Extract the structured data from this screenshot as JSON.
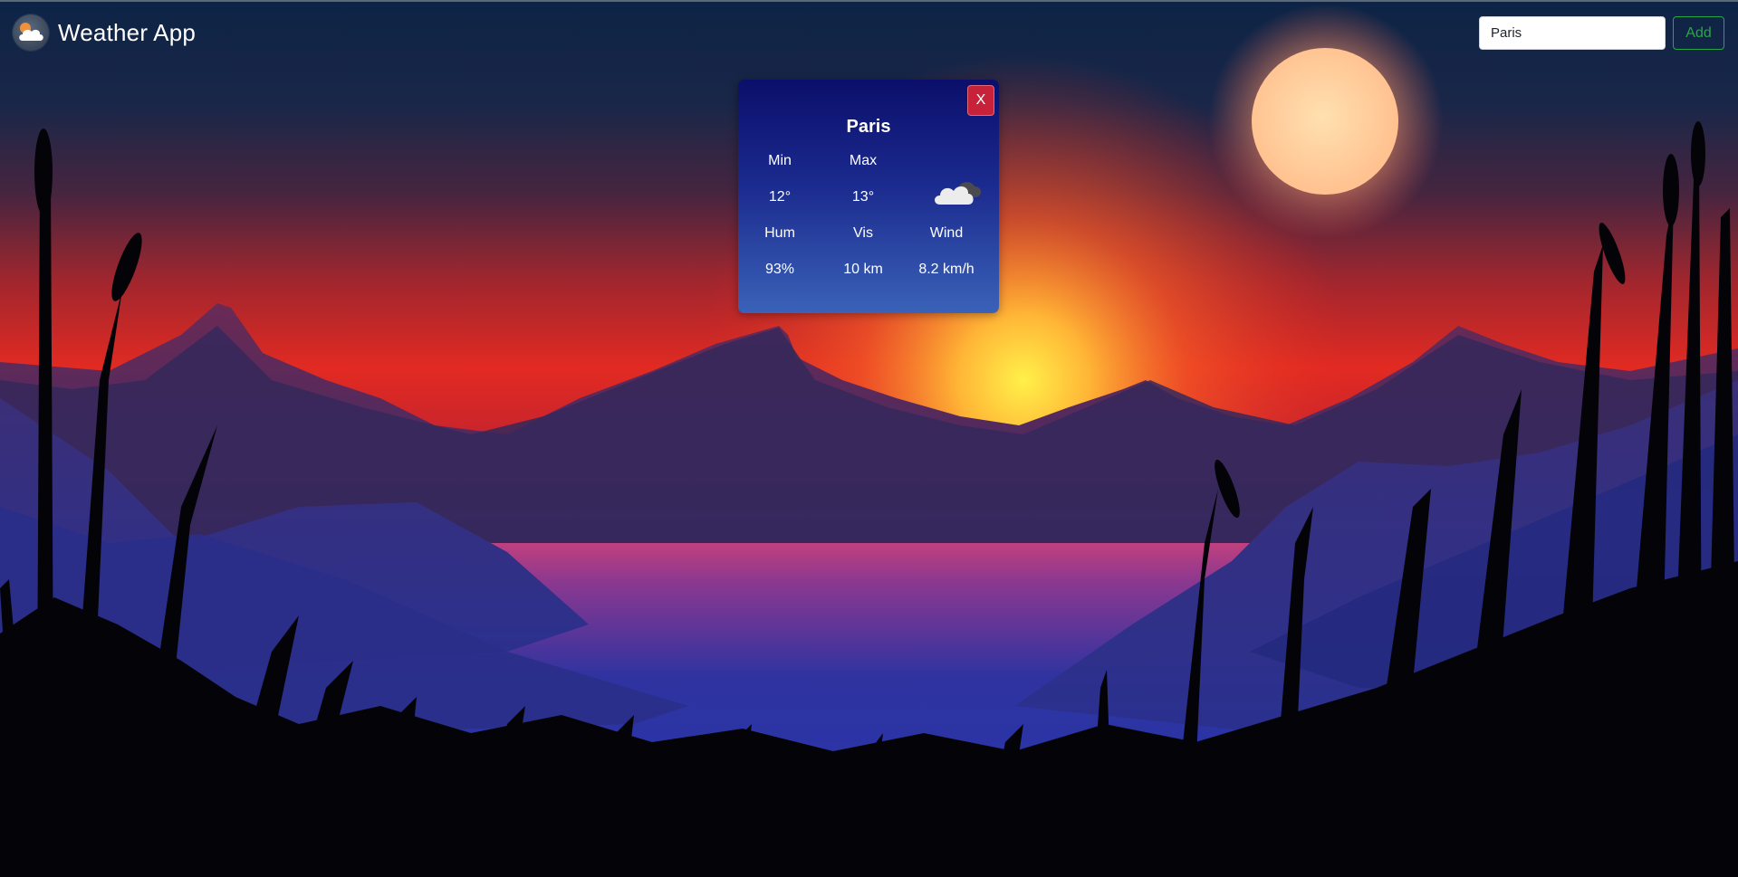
{
  "app": {
    "title": "Weather App",
    "logo_icon": "cloud-sun-icon"
  },
  "search": {
    "value": "Paris",
    "add_label": "Add"
  },
  "card": {
    "city": "Paris",
    "close_label": "X",
    "min_label": "Min",
    "max_label": "Max",
    "min_value": "12°",
    "max_value": "13°",
    "condition_icon": "cloud-icon",
    "hum_label": "Hum",
    "vis_label": "Vis",
    "wind_label": "Wind",
    "hum_value": "93%",
    "vis_value": "10 km",
    "wind_value": "8.2 km/h"
  },
  "colors": {
    "add_button": "#28a745",
    "close_button": "#c8213a",
    "card_top": "#0b0f6b",
    "card_bottom": "#3a62b8"
  }
}
